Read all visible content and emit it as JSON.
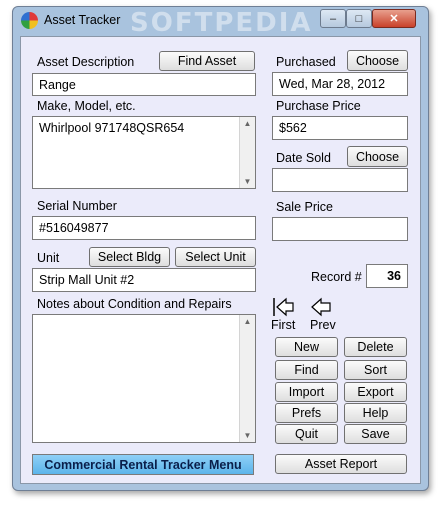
{
  "window": {
    "title": "Asset Tracker",
    "watermark": "SOFTPEDIA",
    "controls": {
      "minimize": "–",
      "maximize": "□",
      "close": "✕"
    }
  },
  "asset": {
    "description_label": "Asset Description",
    "find_asset_label": "Find Asset",
    "description_value": "Range",
    "make_model_label": "Make, Model, etc.",
    "make_model_value": "Whirlpool 971748QSR654",
    "serial_label": "Serial Number",
    "serial_value": "#516049877",
    "unit_label": "Unit",
    "select_bldg_label": "Select Bldg",
    "select_unit_label": "Select Unit",
    "unit_value": "Strip Mall Unit #2",
    "notes_label": "Notes about Condition and Repairs",
    "notes_value": ""
  },
  "purchase": {
    "purchased_label": "Purchased",
    "choose_label": "Choose",
    "purchased_value": "Wed, Mar 28, 2012",
    "price_label": "Purchase Price",
    "price_value": "$562",
    "date_sold_label": "Date Sold",
    "date_sold_value": "",
    "sale_price_label": "Sale Price",
    "sale_price_value": ""
  },
  "record": {
    "label": "Record #",
    "value": "36"
  },
  "navigation": {
    "first_label": "First",
    "prev_label": "Prev"
  },
  "actions": {
    "new": "New",
    "delete": "Delete",
    "find": "Find",
    "sort": "Sort",
    "import": "Import",
    "export": "Export",
    "prefs": "Prefs",
    "help": "Help",
    "quit": "Quit",
    "save": "Save",
    "asset_report": "Asset Report",
    "menu": "Commercial Rental Tracker Menu"
  },
  "colors": {
    "client_bg": "#ebebfa",
    "menu_button": "#6cc0f0",
    "frame": "#a9c3de"
  }
}
